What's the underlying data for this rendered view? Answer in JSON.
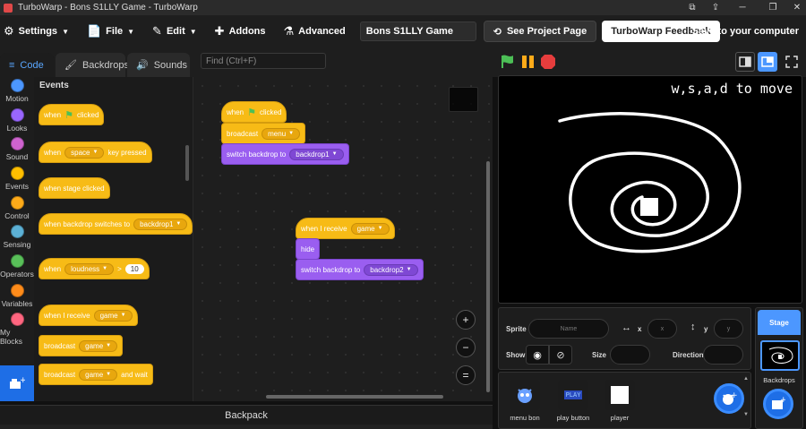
{
  "window": {
    "title": "TurboWarp - Bons S1LLY Game - TurboWarp"
  },
  "menubar": {
    "settings": "Settings",
    "file": "File",
    "edit": "Edit",
    "addons": "Addons",
    "advanced": "Advanced",
    "project_title": "Bons S1LLY Game",
    "see_project": "See Project Page",
    "feedback": "TurboWarp Feedback",
    "save": "Save to your computer"
  },
  "tabs": {
    "code": "Code",
    "backdrops": "Backdrops",
    "sounds": "Sounds"
  },
  "find": {
    "placeholder": "Find (Ctrl+F)"
  },
  "categories": [
    {
      "label": "Motion",
      "color": "#4c97ff"
    },
    {
      "label": "Looks",
      "color": "#9966ff"
    },
    {
      "label": "Sound",
      "color": "#cf63cf"
    },
    {
      "label": "Events",
      "color": "#ffbf00"
    },
    {
      "label": "Control",
      "color": "#ffab19"
    },
    {
      "label": "Sensing",
      "color": "#5cb1d6"
    },
    {
      "label": "Operators",
      "color": "#59c059"
    },
    {
      "label": "Variables",
      "color": "#ff8c1a"
    },
    {
      "label": "My Blocks",
      "color": "#ff6680"
    }
  ],
  "palette": {
    "title": "Events",
    "when": "when",
    "clicked": "clicked",
    "key_space": "space",
    "key_pressed": "key pressed",
    "stage_clicked": "when stage clicked",
    "backdrop_switches": "when backdrop switches to",
    "backdrop1": "backdrop1",
    "loudness": "loudness",
    "gt": ">",
    "ten": "10",
    "when_receive": "when I receive",
    "game": "game",
    "broadcast": "broadcast",
    "and_wait": "and wait"
  },
  "script": {
    "when": "when",
    "clicked": "clicked",
    "broadcast": "broadcast",
    "menu": "menu",
    "switch_backdrop": "switch backdrop to",
    "backdrop1": "backdrop1",
    "when_receive": "when I receive",
    "game": "game",
    "hide": "hide",
    "backdrop2": "backdrop2"
  },
  "zoom": {
    "in": "+",
    "out": "−",
    "reset": "="
  },
  "backpack": "Backpack",
  "stage": {
    "text": "w,s,a,d to move"
  },
  "sprite_info": {
    "sprite_label": "Sprite",
    "name_placeholder": "Name",
    "x_label": "x",
    "x_placeholder": "x",
    "y_label": "y",
    "y_placeholder": "y",
    "show_label": "Show",
    "size_label": "Size",
    "direction_label": "Direction"
  },
  "sprites": [
    {
      "name": "menu bon"
    },
    {
      "name": "play button",
      "thumb_text": "PLAY"
    },
    {
      "name": "player"
    }
  ],
  "stage_pane": {
    "tab": "Stage",
    "backdrops": "Backdrops"
  },
  "colors": {
    "events": "#f7bb16",
    "looks": "#9a5ef0",
    "accent": "#4c97ff"
  }
}
